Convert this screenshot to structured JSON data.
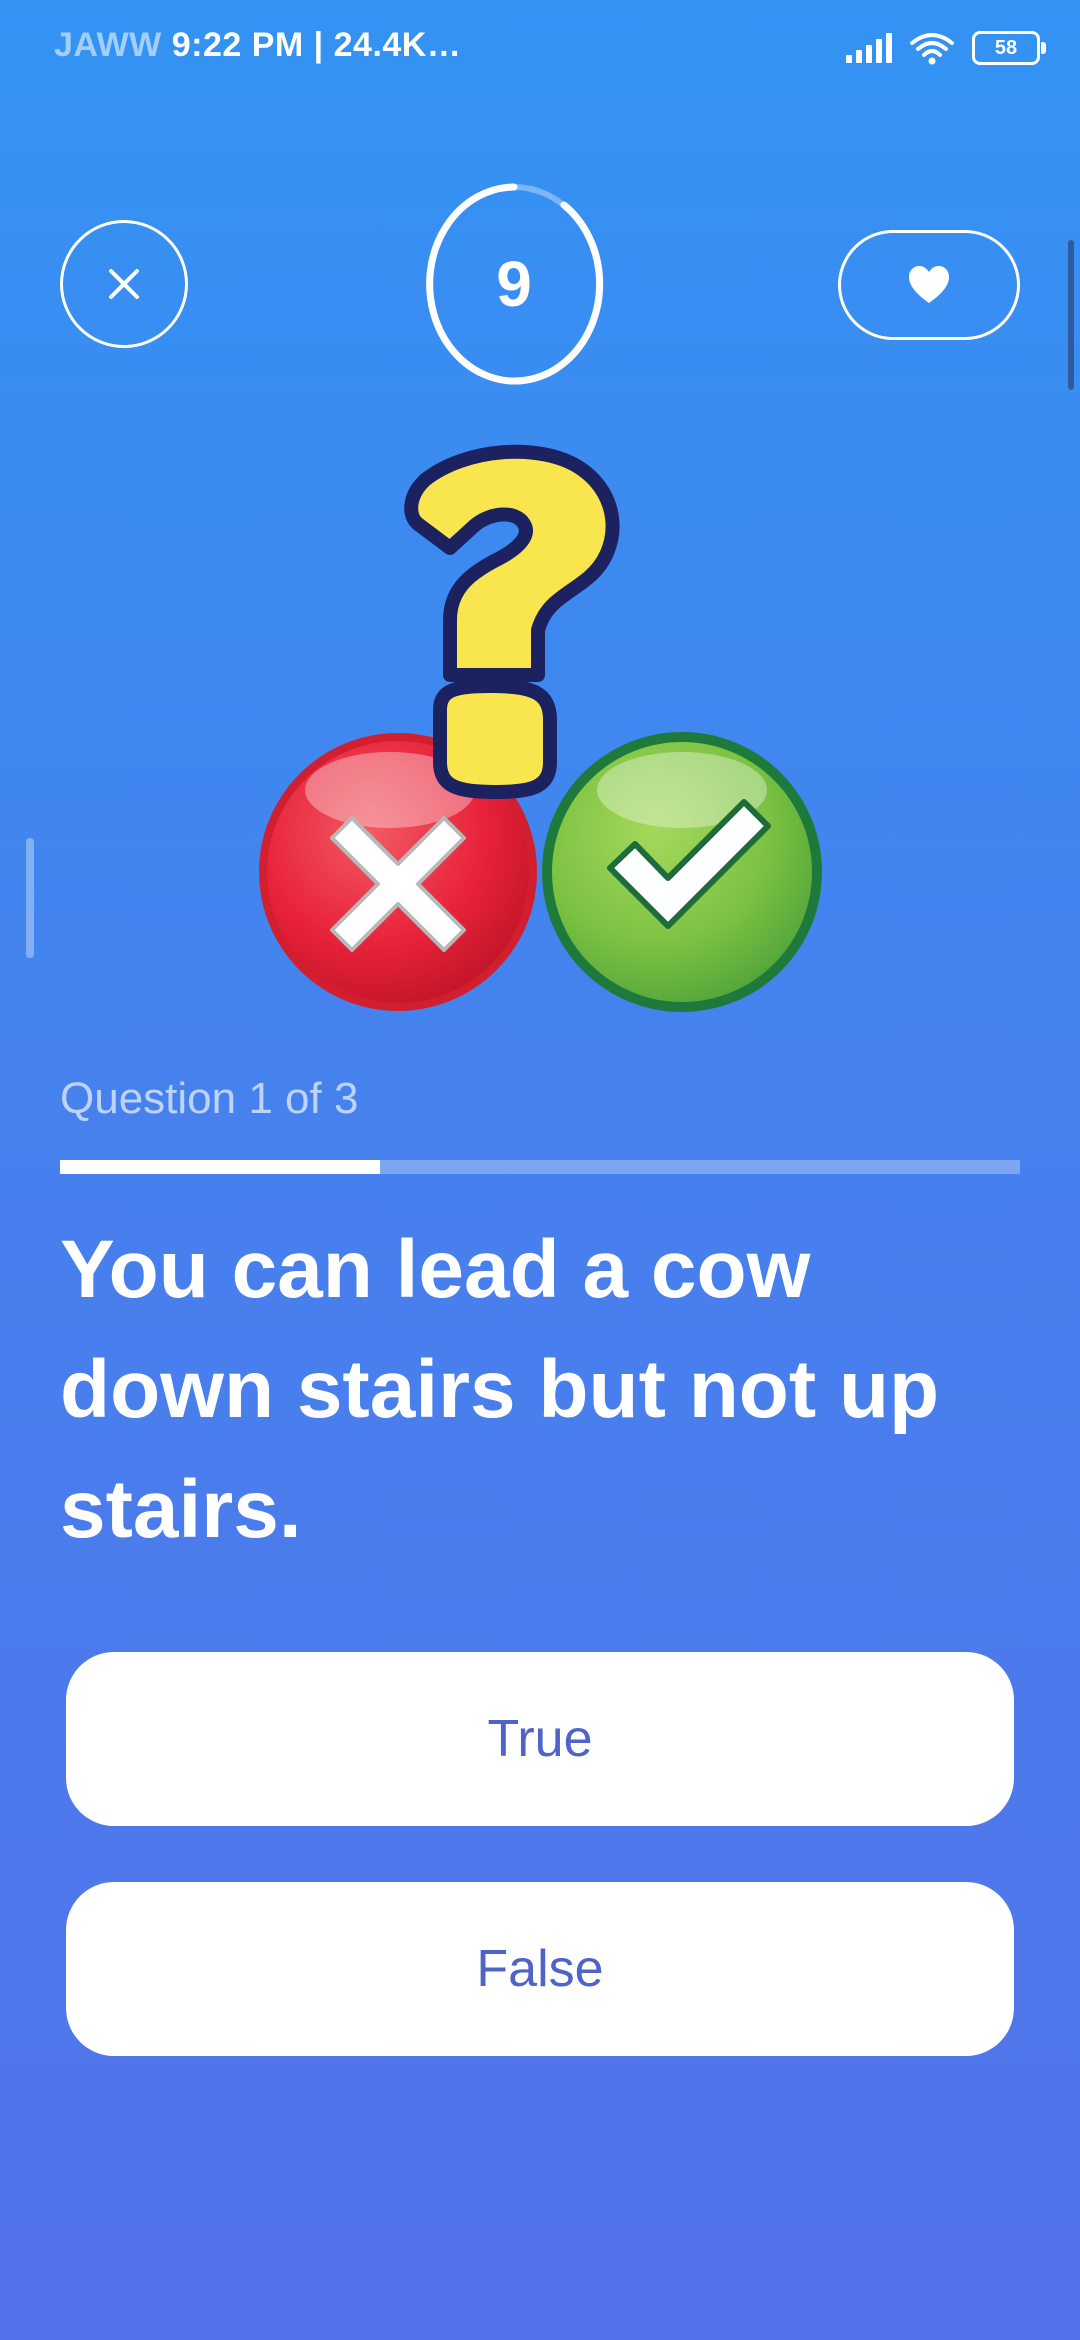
{
  "status_bar": {
    "carrier": "JAWW",
    "time_speed": "9:22 PM | 24.4K…",
    "battery": "58"
  },
  "header": {
    "close_icon": "close-icon",
    "timer_value": "9",
    "timer_remaining_fraction": 0.85,
    "heart_icon": "heart-icon"
  },
  "illustration": {
    "icons": [
      "question-mark-icon",
      "wrong-x-icon",
      "correct-check-icon"
    ],
    "colors": {
      "question": "#F9E64F",
      "wrong": "#E8223A",
      "correct": "#7CC242"
    }
  },
  "quiz": {
    "counter": "Question 1 of 3",
    "progress_fraction": 0.333,
    "question": "You can lead a cow down stairs but not up stairs.",
    "answers": [
      {
        "label": "True"
      },
      {
        "label": "False"
      }
    ]
  },
  "colors": {
    "bg_top": "#3393F3",
    "bg_bottom": "#5372EA",
    "answer_text": "#4F63C9"
  }
}
